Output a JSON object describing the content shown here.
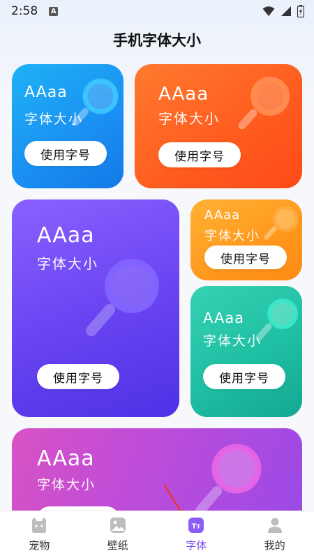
{
  "status_bar": {
    "time": "2:58",
    "notification_badge": "A"
  },
  "page_title": "手机字体大小",
  "cards": [
    {
      "line1": "AAaa",
      "line2": "字体大小",
      "button": "使用字号",
      "color": "#1a8ff2"
    },
    {
      "line1": "AAaa",
      "line2": "字体大小",
      "button": "使用字号",
      "color": "#ff5d1f"
    },
    {
      "line1": "AAaa",
      "line2": "字体大小",
      "button": "使用字号",
      "color": "#6a45f2"
    },
    {
      "line1": "AAaa",
      "line2": "字体大小",
      "button": "使用字号",
      "color": "#ff981c"
    },
    {
      "line1": "AAaa",
      "line2": "字体大小",
      "button": "使用字号",
      "color": "#1fbfa3"
    },
    {
      "line1": "AAaa",
      "line2": "字体大小",
      "color": "#c04cd8"
    }
  ],
  "tab_bar": {
    "items": [
      {
        "label": "宠物",
        "icon": "pet-icon",
        "active": false
      },
      {
        "label": "壁纸",
        "icon": "wallpaper-icon",
        "active": false
      },
      {
        "label": "字体",
        "icon": "font-icon",
        "active": true
      },
      {
        "label": "我的",
        "icon": "profile-icon",
        "active": false
      }
    ],
    "active_color": "#7b4df3"
  }
}
